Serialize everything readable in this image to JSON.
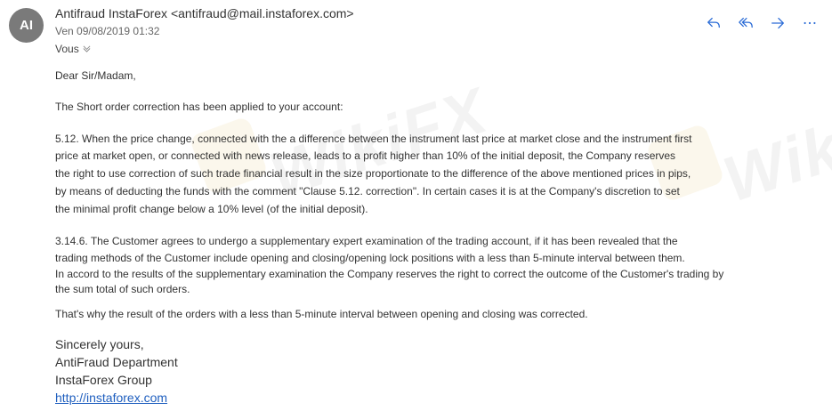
{
  "sender": {
    "initials": "AI",
    "name_line": "Antifraud InstaForex <antifraud@mail.instaforex.com>",
    "date": "Ven 09/08/2019 01:32",
    "to": "Vous"
  },
  "actions": [
    {
      "name": "reply",
      "icon": "reply-icon"
    },
    {
      "name": "reply-all",
      "icon": "reply-all-icon"
    },
    {
      "name": "forward",
      "icon": "forward-icon"
    },
    {
      "name": "more",
      "icon": "more-icon"
    }
  ],
  "body": {
    "greeting": "Dear Sir/Madam,",
    "intro": "The Short order correction has been applied to your account:",
    "clause_512": [
      "5.12. When the price change, connected with the a difference between the instrument last price at market close and the instrument first",
      "price at market open, or connected with news release, leads to a profit higher than 10% of the initial deposit, the Company reserves",
      "the right to use correction of such trade financial result in the size proportionate to the difference of the above mentioned prices in pips,",
      "by means of deducting the funds with the comment \"Clause 5.12. correction\". In certain cases it is at the Company's discretion to set",
      "the minimal profit change below a 10% level (of the initial deposit)."
    ],
    "clause_3146": [
      "3.14.6. The Customer agrees to undergo a supplementary expert examination of the trading account, if it has been revealed that the",
      "trading methods of the Customer include opening and closing/opening lock positions with a less than 5-minute interval between them.",
      "In accord to the results of the supplementary examination the Company reserves the right to correct the outcome of the Customer's trading by",
      "the sum total of such orders."
    ],
    "conclusion": "That's why the result of the orders with a less than 5-minute interval between opening and closing was corrected.",
    "signature": [
      "Sincerely yours,",
      "AntiFraud Department",
      "InstaForex Group"
    ],
    "link": "http://instaforex.com"
  },
  "watermark": "WikiFX"
}
